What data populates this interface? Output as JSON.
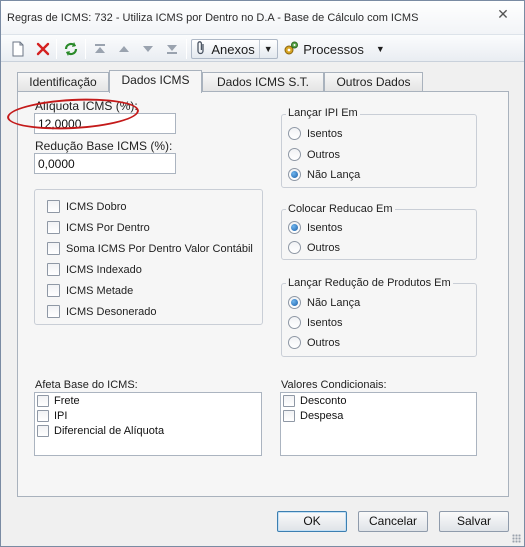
{
  "window": {
    "title": "Regras de ICMS: 732 - Utiliza ICMS por Dentro no D.A - Base de Cálculo com ICMS"
  },
  "toolbar": {
    "icons": [
      "new-document-icon",
      "delete-icon",
      "refresh-icon",
      "move-first-icon",
      "move-up-icon",
      "move-down-icon",
      "move-last-icon",
      "paperclip-icon",
      "gear-icon"
    ],
    "anexos_label": "Anexos",
    "processos_label": "Processos"
  },
  "tabs": [
    {
      "label": "Identificação",
      "active": false
    },
    {
      "label": "Dados ICMS",
      "active": true
    },
    {
      "label": "Dados ICMS S.T.",
      "active": false
    },
    {
      "label": "Outros Dados",
      "active": false
    }
  ],
  "fields": {
    "aliquota": {
      "label": "Alíquota ICMS (%):",
      "value": "12,0000"
    },
    "reducao": {
      "label": "Redução Base ICMS (%):",
      "value": "0,0000"
    }
  },
  "icms_options": [
    {
      "label": "ICMS Dobro",
      "checked": false
    },
    {
      "label": "ICMS Por Dentro",
      "checked": false
    },
    {
      "label": "Soma ICMS Por Dentro Valor Contábil",
      "checked": false
    },
    {
      "label": "ICMS Indexado",
      "checked": false
    },
    {
      "label": "ICMS Metade",
      "checked": false
    },
    {
      "label": "ICMS Desonerado",
      "checked": false
    }
  ],
  "lancar_ipi": {
    "title": "Lançar IPI Em",
    "options": [
      {
        "label": "Isentos",
        "selected": false
      },
      {
        "label": "Outros",
        "selected": false
      },
      {
        "label": "Não Lança",
        "selected": true
      }
    ]
  },
  "colocar_reducao": {
    "title": "Colocar Reducao Em",
    "options": [
      {
        "label": "Isentos",
        "selected": true
      },
      {
        "label": "Outros",
        "selected": false
      }
    ]
  },
  "lancar_reducao_produtos": {
    "title": "Lançar Redução de Produtos Em",
    "options": [
      {
        "label": "Não Lança",
        "selected": true
      },
      {
        "label": "Isentos",
        "selected": false
      },
      {
        "label": "Outros",
        "selected": false
      }
    ]
  },
  "afeta_base": {
    "title": "Afeta Base do ICMS:",
    "items": [
      {
        "label": "Frete",
        "checked": false
      },
      {
        "label": "IPI",
        "checked": false
      },
      {
        "label": "Diferencial de Alíquota",
        "checked": false
      }
    ]
  },
  "valores_condicionais": {
    "title": "Valores Condicionais:",
    "items": [
      {
        "label": "Desconto",
        "checked": false
      },
      {
        "label": "Despesa",
        "checked": false
      }
    ]
  },
  "buttons": {
    "ok": "OK",
    "cancel": "Cancelar",
    "save": "Salvar"
  },
  "colors": {
    "highlight_oval": "#c41a1a",
    "radio_selected": "#1c5fa8"
  }
}
